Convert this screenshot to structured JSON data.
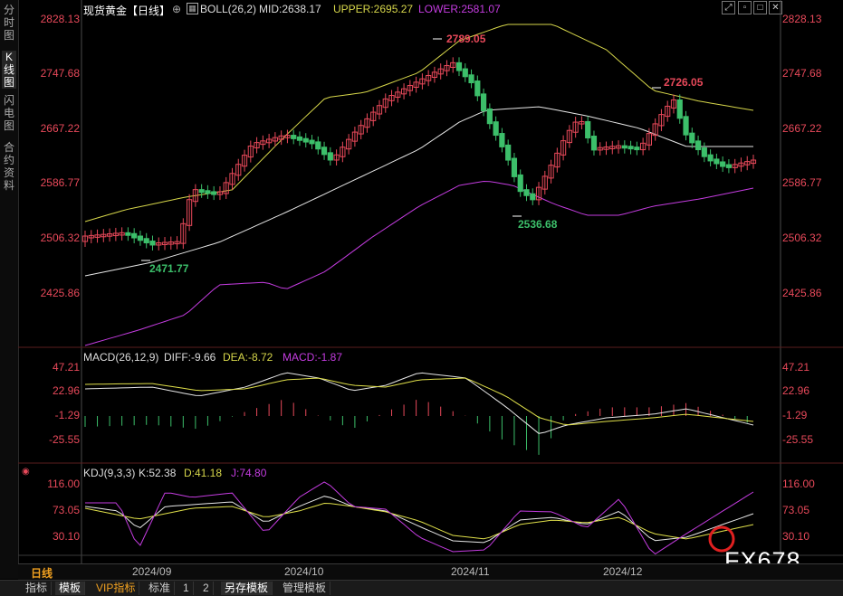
{
  "sidebar": {
    "tabs": [
      "分时图",
      "K线图",
      "闪电图",
      "合约资料"
    ],
    "active_index": 1
  },
  "main": {
    "title": "现货黄金【日线】",
    "boll": {
      "label": "BOLL(26,2)",
      "mid": "MID:2638.17",
      "upper": "UPPER:2695.27",
      "lower": "LOWER:2581.07"
    },
    "y_ticks": [
      "2828.13",
      "2747.68",
      "2667.22",
      "2586.77",
      "2506.32",
      "2425.86"
    ],
    "annotations": {
      "high": "2789.05",
      "low": "2536.68",
      "low_left": "2471.77",
      "peak_dec": "2726.05"
    }
  },
  "macd": {
    "label": "MACD(26,12,9)",
    "diff": "DIFF:-9.66",
    "dea": "DEA:-8.72",
    "macd": "MACD:-1.87",
    "y_ticks": [
      "47.21",
      "22.96",
      "-1.29",
      "-25.55"
    ]
  },
  "kdj": {
    "label": "KDJ(9,3,3)",
    "k": "K:52.38",
    "d": "D:41.18",
    "j": "J:74.80",
    "y_ticks": [
      "116.00",
      "73.05",
      "30.10"
    ]
  },
  "period_label": "日线",
  "dates": [
    "2024/09",
    "2024/10",
    "2024/11",
    "2024/12"
  ],
  "watermark": "FX678",
  "bottom_tabs": [
    "指标",
    "模板",
    "VIP指标",
    "标准",
    "1",
    "2",
    "另存模板",
    "管理模板"
  ],
  "colors": {
    "up": "#e8495a",
    "down": "#3cbf6a",
    "upper": "#d6d64a",
    "mid": "#e6e6e6",
    "lower": "#c43ce0",
    "k": "#e6e6e6",
    "d": "#e0e04a",
    "j": "#c43ce0"
  }
}
